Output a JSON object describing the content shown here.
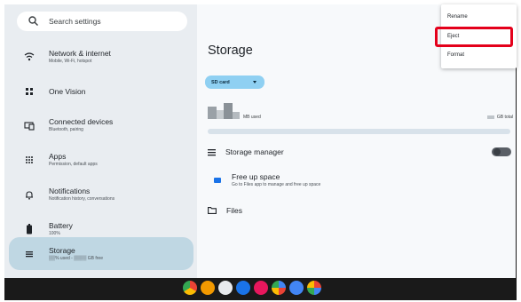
{
  "search": {
    "placeholder": "Search settings",
    "icon": "search-icon"
  },
  "sidebar": {
    "items": [
      {
        "label": "Network & internet",
        "sub": "Mobile, Wi-Fi, hotspot",
        "icon": "wifi-icon"
      },
      {
        "label": "One Vision",
        "sub": "",
        "icon": "grid-icon"
      },
      {
        "label": "Connected devices",
        "sub": "Bluetooth, pairing",
        "icon": "devices-icon"
      },
      {
        "label": "Apps",
        "sub": "Permission, default apps",
        "icon": "apps-icon"
      },
      {
        "label": "Notifications",
        "sub": "Notification history, conversations",
        "icon": "bell-icon"
      },
      {
        "label": "Battery",
        "sub": "100%",
        "icon": "battery-icon"
      },
      {
        "label": "Storage",
        "sub": "▒▒% used - ▒▒▒▒ GB free",
        "icon": "storage-icon",
        "active": true
      }
    ]
  },
  "main": {
    "title": "Storage",
    "storage_selector": "SD card",
    "used_label": "MB used",
    "total_label": "GB total",
    "storage_manager": {
      "label": "Storage manager",
      "toggle_on": false
    },
    "free_up": {
      "title": "Free up space",
      "subtitle": "Go to Files app to manage and free up space"
    },
    "files": {
      "label": "Files"
    }
  },
  "overflow_menu": {
    "items": [
      "Rename",
      "Eject",
      "Format"
    ],
    "highlighted": "Eject"
  },
  "taskbar": {
    "apps": [
      "chrome-icon",
      "camera-icon",
      "settings-icon",
      "photos-icon",
      "files-icon",
      "assistant-icon",
      "play-icon",
      "launcher-icon"
    ]
  },
  "colors": {
    "sidebar_bg": "#e9edf1",
    "main_bg": "#f7f9fb",
    "active_item": "#bfd7e3",
    "chip": "#8fd0f2",
    "highlight": "#e4001b",
    "taskbar": "#1a1a1a"
  }
}
